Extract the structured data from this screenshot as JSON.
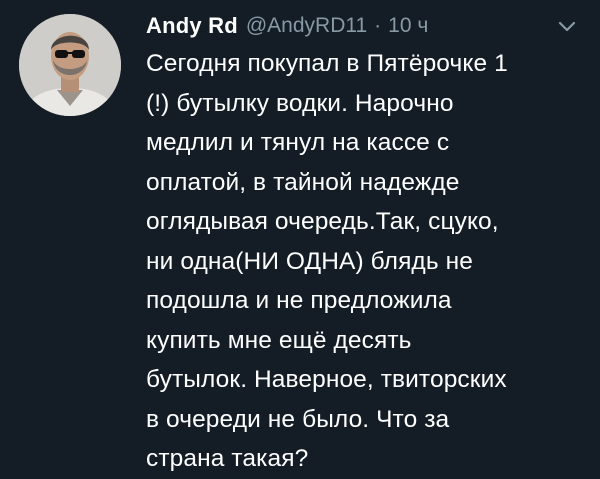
{
  "tweet": {
    "display_name": "Andy Rd",
    "handle": "@AndyRD11",
    "separator": "·",
    "time": "10 ч",
    "text": "Сегодня покупал в Пятёрочке 1\n(!) бутылку водки. Нарочно\nмедлил и тянул на кассе с\nоплатой, в тайной надежде\nоглядывая очередь.Так, сцуко,\nни одна(НИ ОДНА) блядь не\nподошла и не предложила\nкупить мне ещё десять\nбутылок. Наверное, твиторских\nв очереди не было. Что за\nстрана такая?",
    "avatar_icon": "user-avatar-photo",
    "menu_icon": "chevron-down-icon"
  },
  "colors": {
    "background": "#141d26",
    "primary_text": "#ffffff",
    "secondary_text": "#8899a6"
  }
}
